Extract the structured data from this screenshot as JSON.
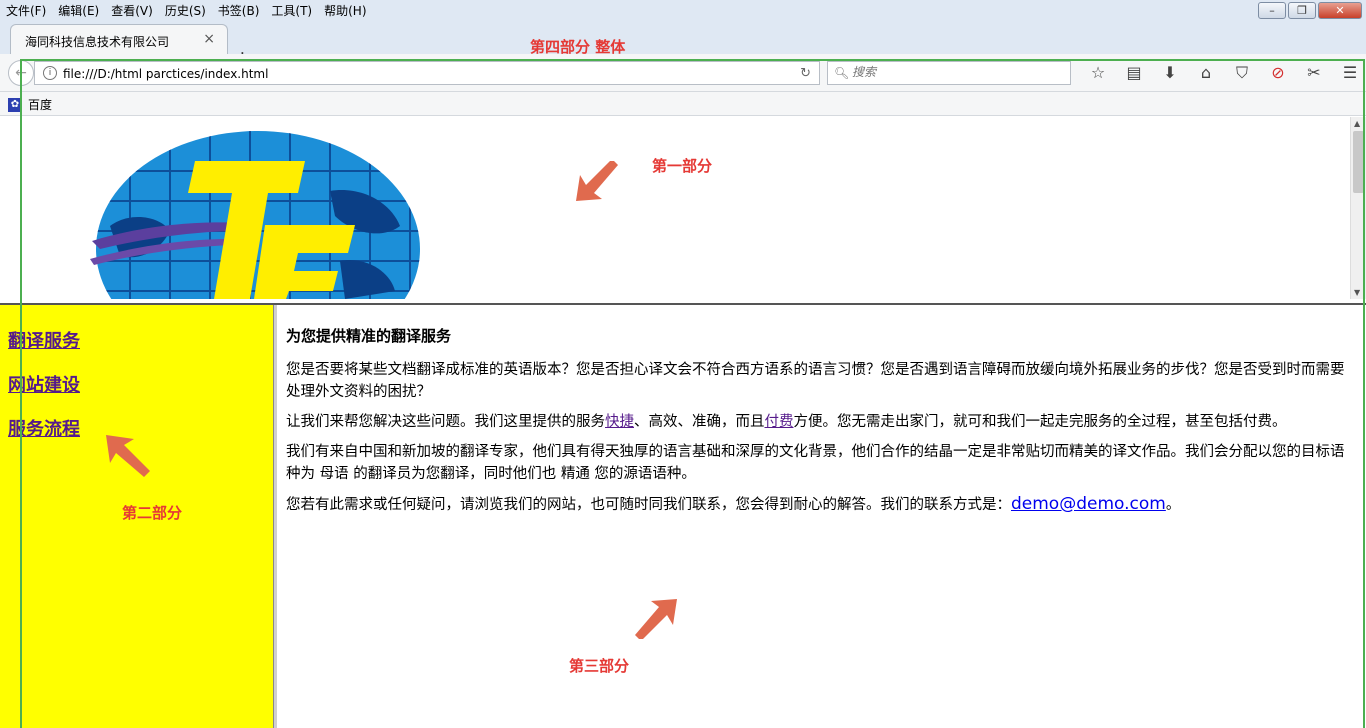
{
  "menubar": {
    "items": [
      "文件(F)",
      "编辑(E)",
      "查看(V)",
      "历史(S)",
      "书签(B)",
      "工具(T)",
      "帮助(H)"
    ]
  },
  "window_controls": {
    "minimize": "–",
    "restore": "❐",
    "close": "✕"
  },
  "tab": {
    "title": "海同科技信息技术有限公司",
    "close": "×",
    "new_tab": "+"
  },
  "navbar": {
    "url": "file:///D:/html parctices/index.html",
    "search_placeholder": "搜索",
    "icons": [
      "star-icon",
      "reader-icon",
      "download-icon",
      "home-icon",
      "pocket-icon",
      "adblock-icon",
      "addon-icon",
      "menu-icon"
    ]
  },
  "bookmarks": {
    "items": [
      "百度"
    ]
  },
  "annotations": {
    "part1": "第一部分",
    "part2": "第二部分",
    "part3": "第三部分",
    "part4": "第四部分 整体"
  },
  "nav": {
    "links": [
      "翻译服务",
      "网站建设",
      "服务流程"
    ]
  },
  "content": {
    "heading": "为您提供精准的翻译服务",
    "p1": "您是否要将某些文档翻译成标准的英语版本？您是否担心译文会不符合西方语系的语言习惯？您是否遇到语言障碍而放缓向境外拓展业务的步伐？您是否受到时而需要处理外文资料的困扰？",
    "p2_a": "让我们来帮您解决这些问题。我们这里提供的服务",
    "p2_link1": "快捷",
    "p2_b": "、高效、准确，而且",
    "p2_link2": "付费",
    "p2_c": "方便。您无需走出家门，就可和我们一起走完服务的全过程，甚至包括付费。",
    "p3": "我们有来自中国和新加坡的翻译专家，他们具有得天独厚的语言基础和深厚的文化背景，他们合作的结晶一定是非常贴切而精美的译文作品。我们会分配以您的目标语种为 母语 的翻译员为您翻译，同时他们也 精通 您的源语语种。",
    "p4_a": "您若有此需求或任何疑问，请浏览我们的网站，也可随时同我们联系，您会得到耐心的解答。我们的联系方式是：",
    "email": "demo@demo.com",
    "p4_b": "。"
  },
  "colors": {
    "annotation": "#e53935",
    "nav_bg": "#ffff00",
    "frame_border": "#4caf50",
    "link_visited": "#551a8b"
  }
}
